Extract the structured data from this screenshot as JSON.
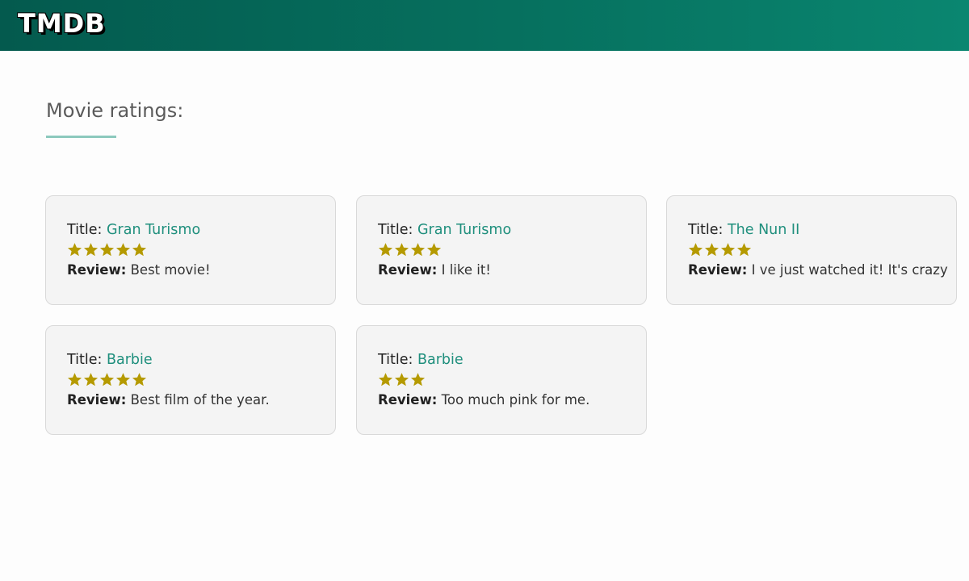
{
  "header": {
    "logo": "TMDB"
  },
  "main": {
    "heading": "Movie ratings:"
  },
  "colors": {
    "header_dark": "#045a4e",
    "header_light": "#0a8670",
    "accent_title": "#1f8f7d",
    "star": "#b59a00",
    "underline": "#8cc9bd"
  },
  "labels": {
    "title": "Title:",
    "review": "Review:"
  },
  "cards": [
    {
      "title": "Gran Turismo",
      "stars": 5,
      "review": "Best movie!"
    },
    {
      "title": "Gran Turismo",
      "stars": 4,
      "review": "I like it!"
    },
    {
      "title": "The Nun II",
      "stars": 4,
      "review": "I ve just watched it! It's crazy"
    },
    {
      "title": "Barbie",
      "stars": 5,
      "review": "Best film of the year."
    },
    {
      "title": "Barbie",
      "stars": 3,
      "review": "Too much pink for me."
    }
  ]
}
